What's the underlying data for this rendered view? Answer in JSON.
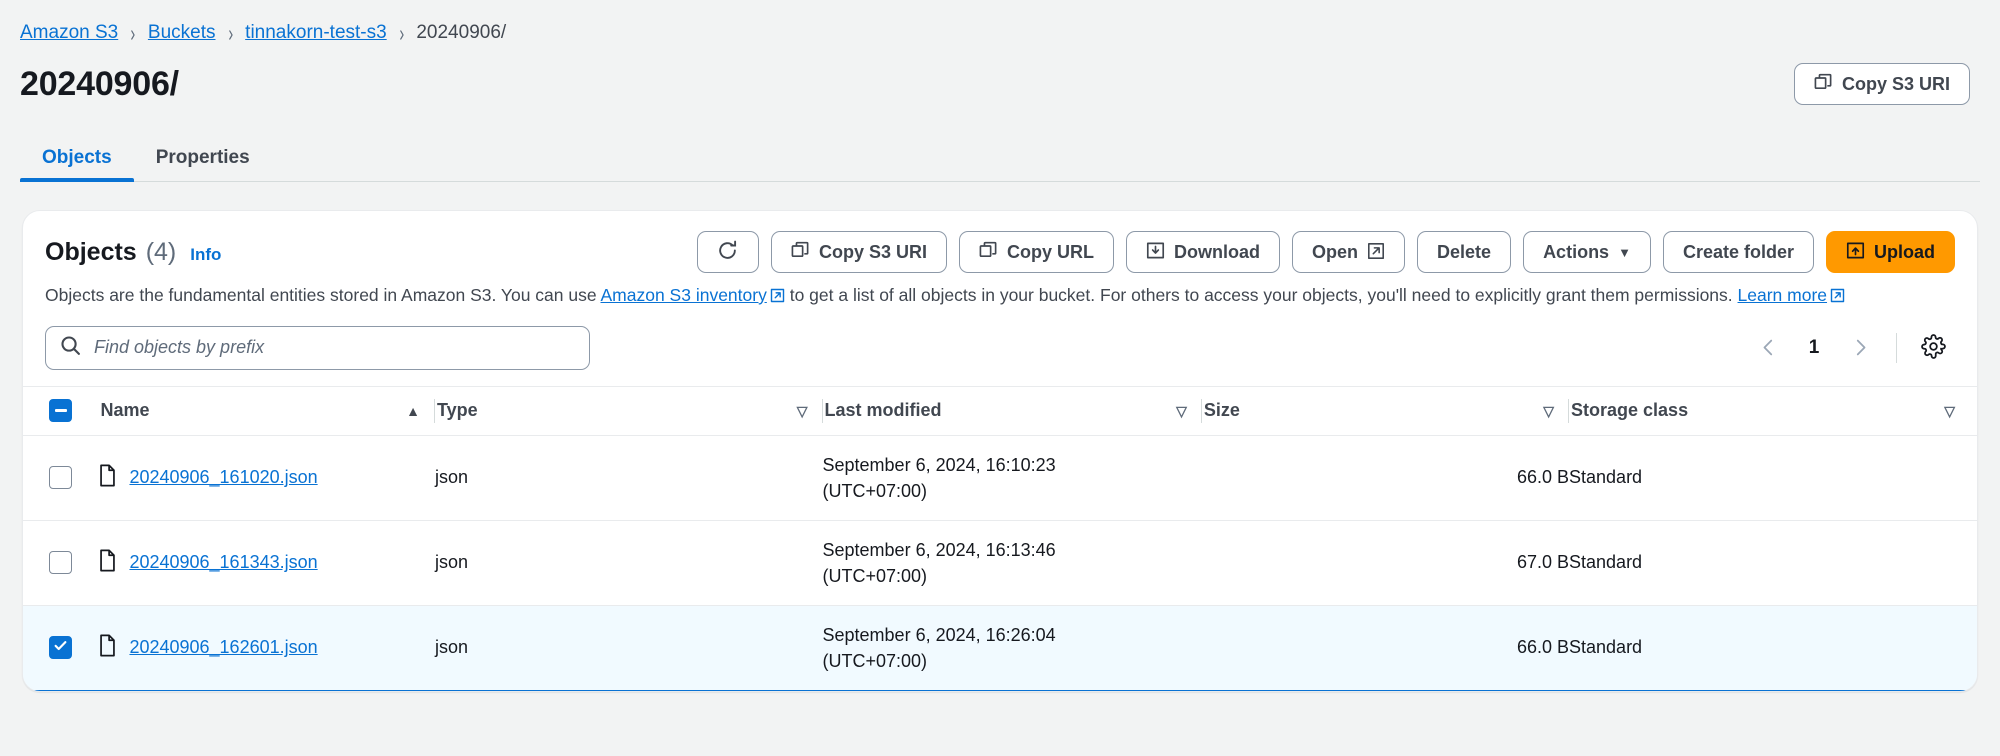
{
  "breadcrumb": {
    "items": [
      {
        "label": "Amazon S3",
        "link": true
      },
      {
        "label": "Buckets",
        "link": true
      },
      {
        "label": "tinnakorn-test-s3",
        "link": true
      },
      {
        "label": "20240906/",
        "link": false
      }
    ],
    "separator": "›"
  },
  "page": {
    "title": "20240906/",
    "copy_uri_button": "Copy S3 URI"
  },
  "tabs": [
    {
      "label": "Objects",
      "active": true
    },
    {
      "label": "Properties",
      "active": false
    }
  ],
  "objects_panel": {
    "title": "Objects",
    "count": "(4)",
    "info_label": "Info",
    "description_part1": "Objects are the fundamental entities stored in Amazon S3. You can use ",
    "description_link1": "Amazon S3 inventory",
    "description_part2": " to get a list of all objects in your bucket. For others to access your objects, you'll need to explicitly grant them permissions. ",
    "description_link2": "Learn more",
    "toolbar": {
      "refresh_label": "",
      "copy_s3_uri": "Copy S3 URI",
      "copy_url": "Copy URL",
      "download": "Download",
      "open": "Open",
      "delete": "Delete",
      "actions": "Actions",
      "actions_caret": "▼",
      "create_folder": "Create folder",
      "upload": "Upload"
    },
    "search": {
      "placeholder": "Find objects by prefix",
      "value": ""
    },
    "pagination": {
      "prev": "‹",
      "page": "1",
      "next": "›"
    },
    "table": {
      "columns": [
        {
          "label": "Name",
          "sort": "asc",
          "sort_icon": "▲"
        },
        {
          "label": "Type",
          "sort": "none",
          "sort_icon": "▽"
        },
        {
          "label": "Last modified",
          "sort": "none",
          "sort_icon": "▽"
        },
        {
          "label": "Size",
          "sort": "none",
          "sort_icon": "▽"
        },
        {
          "label": "Storage class",
          "sort": "none",
          "sort_icon": "▽"
        }
      ],
      "header_checkbox_state": "indeterminate",
      "rows": [
        {
          "selected": false,
          "name": "20240906_161020.json",
          "type": "json",
          "last_modified_line1": "September 6, 2024, 16:10:23",
          "last_modified_line2": "(UTC+07:00)",
          "size": "66.0 B",
          "storage_class": "Standard"
        },
        {
          "selected": false,
          "name": "20240906_161343.json",
          "type": "json",
          "last_modified_line1": "September 6, 2024, 16:13:46",
          "last_modified_line2": "(UTC+07:00)",
          "size": "67.0 B",
          "storage_class": "Standard"
        },
        {
          "selected": true,
          "name": "20240906_162601.json",
          "type": "json",
          "last_modified_line1": "September 6, 2024, 16:26:04",
          "last_modified_line2": "(UTC+07:00)",
          "size": "66.0 B",
          "storage_class": "Standard"
        }
      ]
    }
  },
  "colors": {
    "link": "#0972d3",
    "accent_orange": "#ff9900",
    "selected_row_bg": "#f1faff",
    "page_bg": "#f2f3f3"
  }
}
